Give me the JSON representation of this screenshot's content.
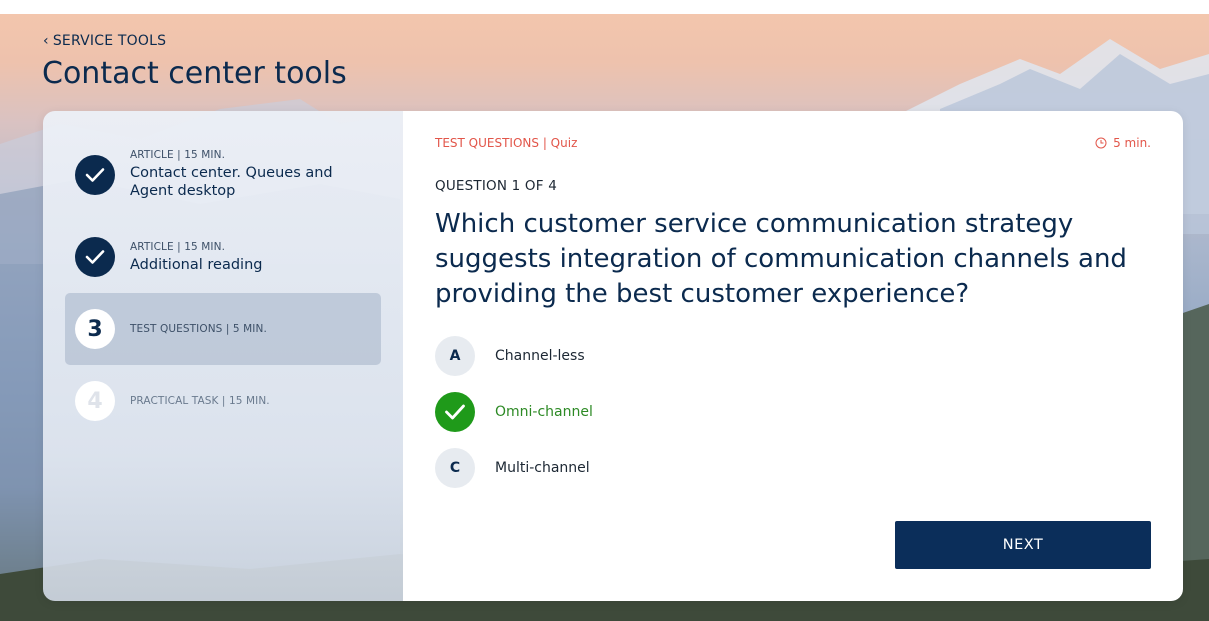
{
  "header": {
    "back_label": "SERVICE TOOLS",
    "title": "Contact center tools"
  },
  "steps": [
    {
      "meta": "ARTICLE | 15 MIN.",
      "name": "Contact center. Queues and Agent desktop",
      "status": "done",
      "number": "1"
    },
    {
      "meta": "ARTICLE | 15 MIN.",
      "name": "Additional reading",
      "status": "done",
      "number": "2"
    },
    {
      "meta": "TEST QUESTIONS | 5 MIN.",
      "name": "",
      "status": "current",
      "number": "3"
    },
    {
      "meta": "PRACTICAL TASK | 15 MIN.",
      "name": "",
      "status": "todo",
      "number": "4"
    }
  ],
  "quiz": {
    "label": "TEST QUESTIONS | Quiz",
    "timer": "5 min.",
    "counter": "QUESTION 1 OF 4",
    "question": "Which customer service communication strategy suggests integration of communication channels and providing the best customer experience?",
    "options": [
      {
        "letter": "A",
        "text": "Channel-less",
        "selected": false
      },
      {
        "letter": "B",
        "text": "Omni-channel",
        "selected": true
      },
      {
        "letter": "C",
        "text": "Multi-channel",
        "selected": false
      }
    ],
    "next_label": "NEXT"
  },
  "colors": {
    "primary": "#0b2a4e",
    "accent": "#e2564a",
    "correct": "#1f9a1a"
  }
}
